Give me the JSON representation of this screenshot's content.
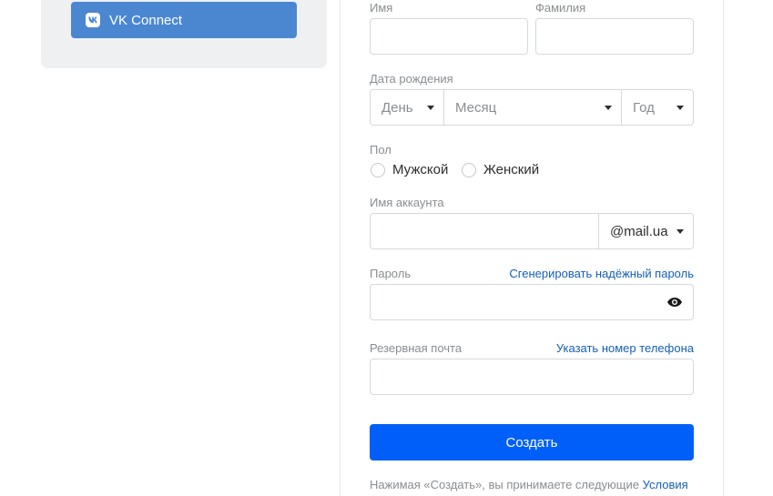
{
  "vk_connect": {
    "label": "VK Connect",
    "icon": "vk-logo-icon"
  },
  "form": {
    "first_name": {
      "label": "Имя",
      "value": ""
    },
    "last_name": {
      "label": "Фамилия",
      "value": ""
    },
    "birth_date": {
      "label": "Дата рождения",
      "day_placeholder": "День",
      "month_placeholder": "Месяц",
      "year_placeholder": "Год"
    },
    "gender": {
      "label": "Пол",
      "options": [
        "Мужской",
        "Женский"
      ],
      "selected": null
    },
    "account": {
      "label": "Имя аккаунта",
      "value": "",
      "domain": "@mail.ua"
    },
    "password": {
      "label": "Пароль",
      "generate_link": "Сгенерировать надёжный пароль",
      "value": "",
      "visibility_icon": "eye-icon"
    },
    "backup_email": {
      "label": "Резервная почта",
      "phone_link": "Указать номер телефона",
      "value": ""
    },
    "submit_label": "Создать",
    "terms_text": "Нажимая «Создать», вы принимаете следующие",
    "terms_link": "Условия"
  },
  "colors": {
    "primary_button": "#005ff9",
    "vk_button": "#4a87d0",
    "link": "#1460b5",
    "label": "#8a8d91"
  }
}
